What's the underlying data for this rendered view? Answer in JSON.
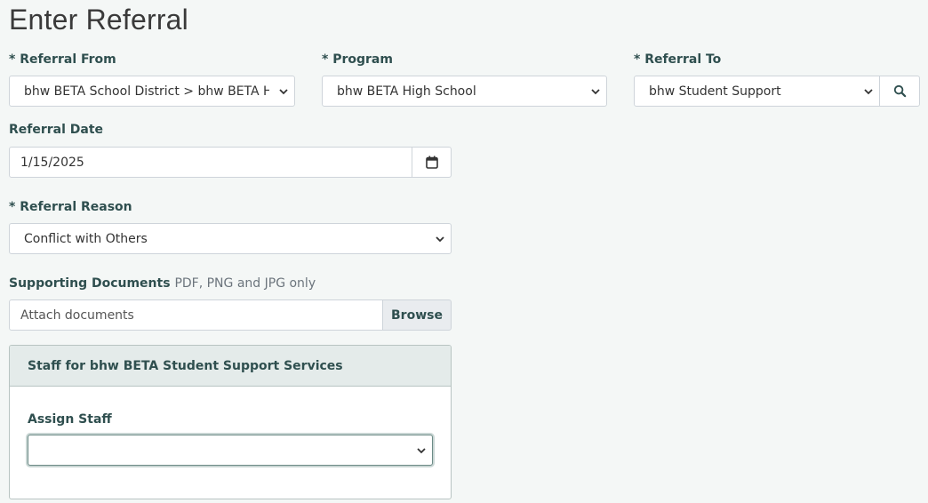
{
  "page": {
    "title": "Enter Referral"
  },
  "referral_from": {
    "label": "* Referral From",
    "value": "bhw BETA School District > bhw BETA High School"
  },
  "program": {
    "label": "* Program",
    "value": "bhw BETA High School"
  },
  "referral_to": {
    "label": "* Referral To",
    "value": "bhw Student Support",
    "search_icon": "search-icon"
  },
  "referral_date": {
    "label": "Referral Date",
    "value": "1/15/2025",
    "calendar_icon": "calendar-icon"
  },
  "referral_reason": {
    "label": "* Referral Reason",
    "value": "Conflict with Others"
  },
  "supporting_documents": {
    "label": "Supporting Documents",
    "hint": "PDF, PNG and JPG only",
    "placeholder": "Attach documents",
    "browse_label": "Browse"
  },
  "staff_panel": {
    "title": "Staff for bhw BETA Student Support Services",
    "assign_label": "Assign Staff",
    "assign_value": ""
  },
  "colors": {
    "background": "#f4f7f6",
    "label": "#2f4f4f",
    "border": "#ced4da",
    "panel_header": "#e4ebea",
    "focus_border": "#6c8a86"
  }
}
